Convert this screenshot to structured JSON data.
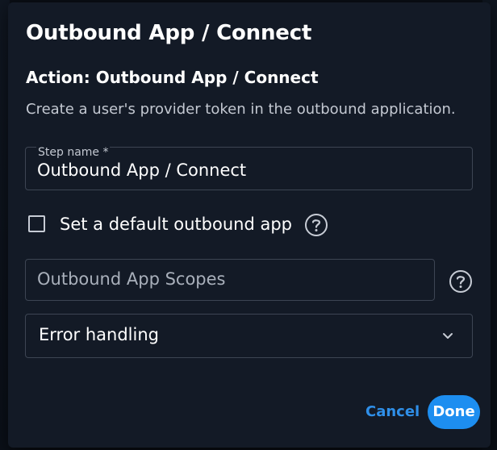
{
  "dialog": {
    "title": "Outbound App / Connect",
    "action_title": "Action: Outbound App / Connect",
    "description": "Create a user's provider token in the outbound application."
  },
  "step_name": {
    "label": "Step name *",
    "value": "Outbound App / Connect"
  },
  "default_app_checkbox": {
    "label": "Set a default outbound app",
    "checked": false,
    "help_icon": "help-circle-icon"
  },
  "scopes": {
    "placeholder": "Outbound App Scopes",
    "help_icon": "help-circle-icon"
  },
  "error_handling": {
    "label": "Error handling",
    "icon": "chevron-down-icon"
  },
  "footer": {
    "cancel_label": "Cancel",
    "done_label": "Done"
  },
  "colors": {
    "dialog_bg": "#131a26",
    "accent": "#1d8ef0",
    "link": "#2f8fe8",
    "border": "#3d4553"
  }
}
